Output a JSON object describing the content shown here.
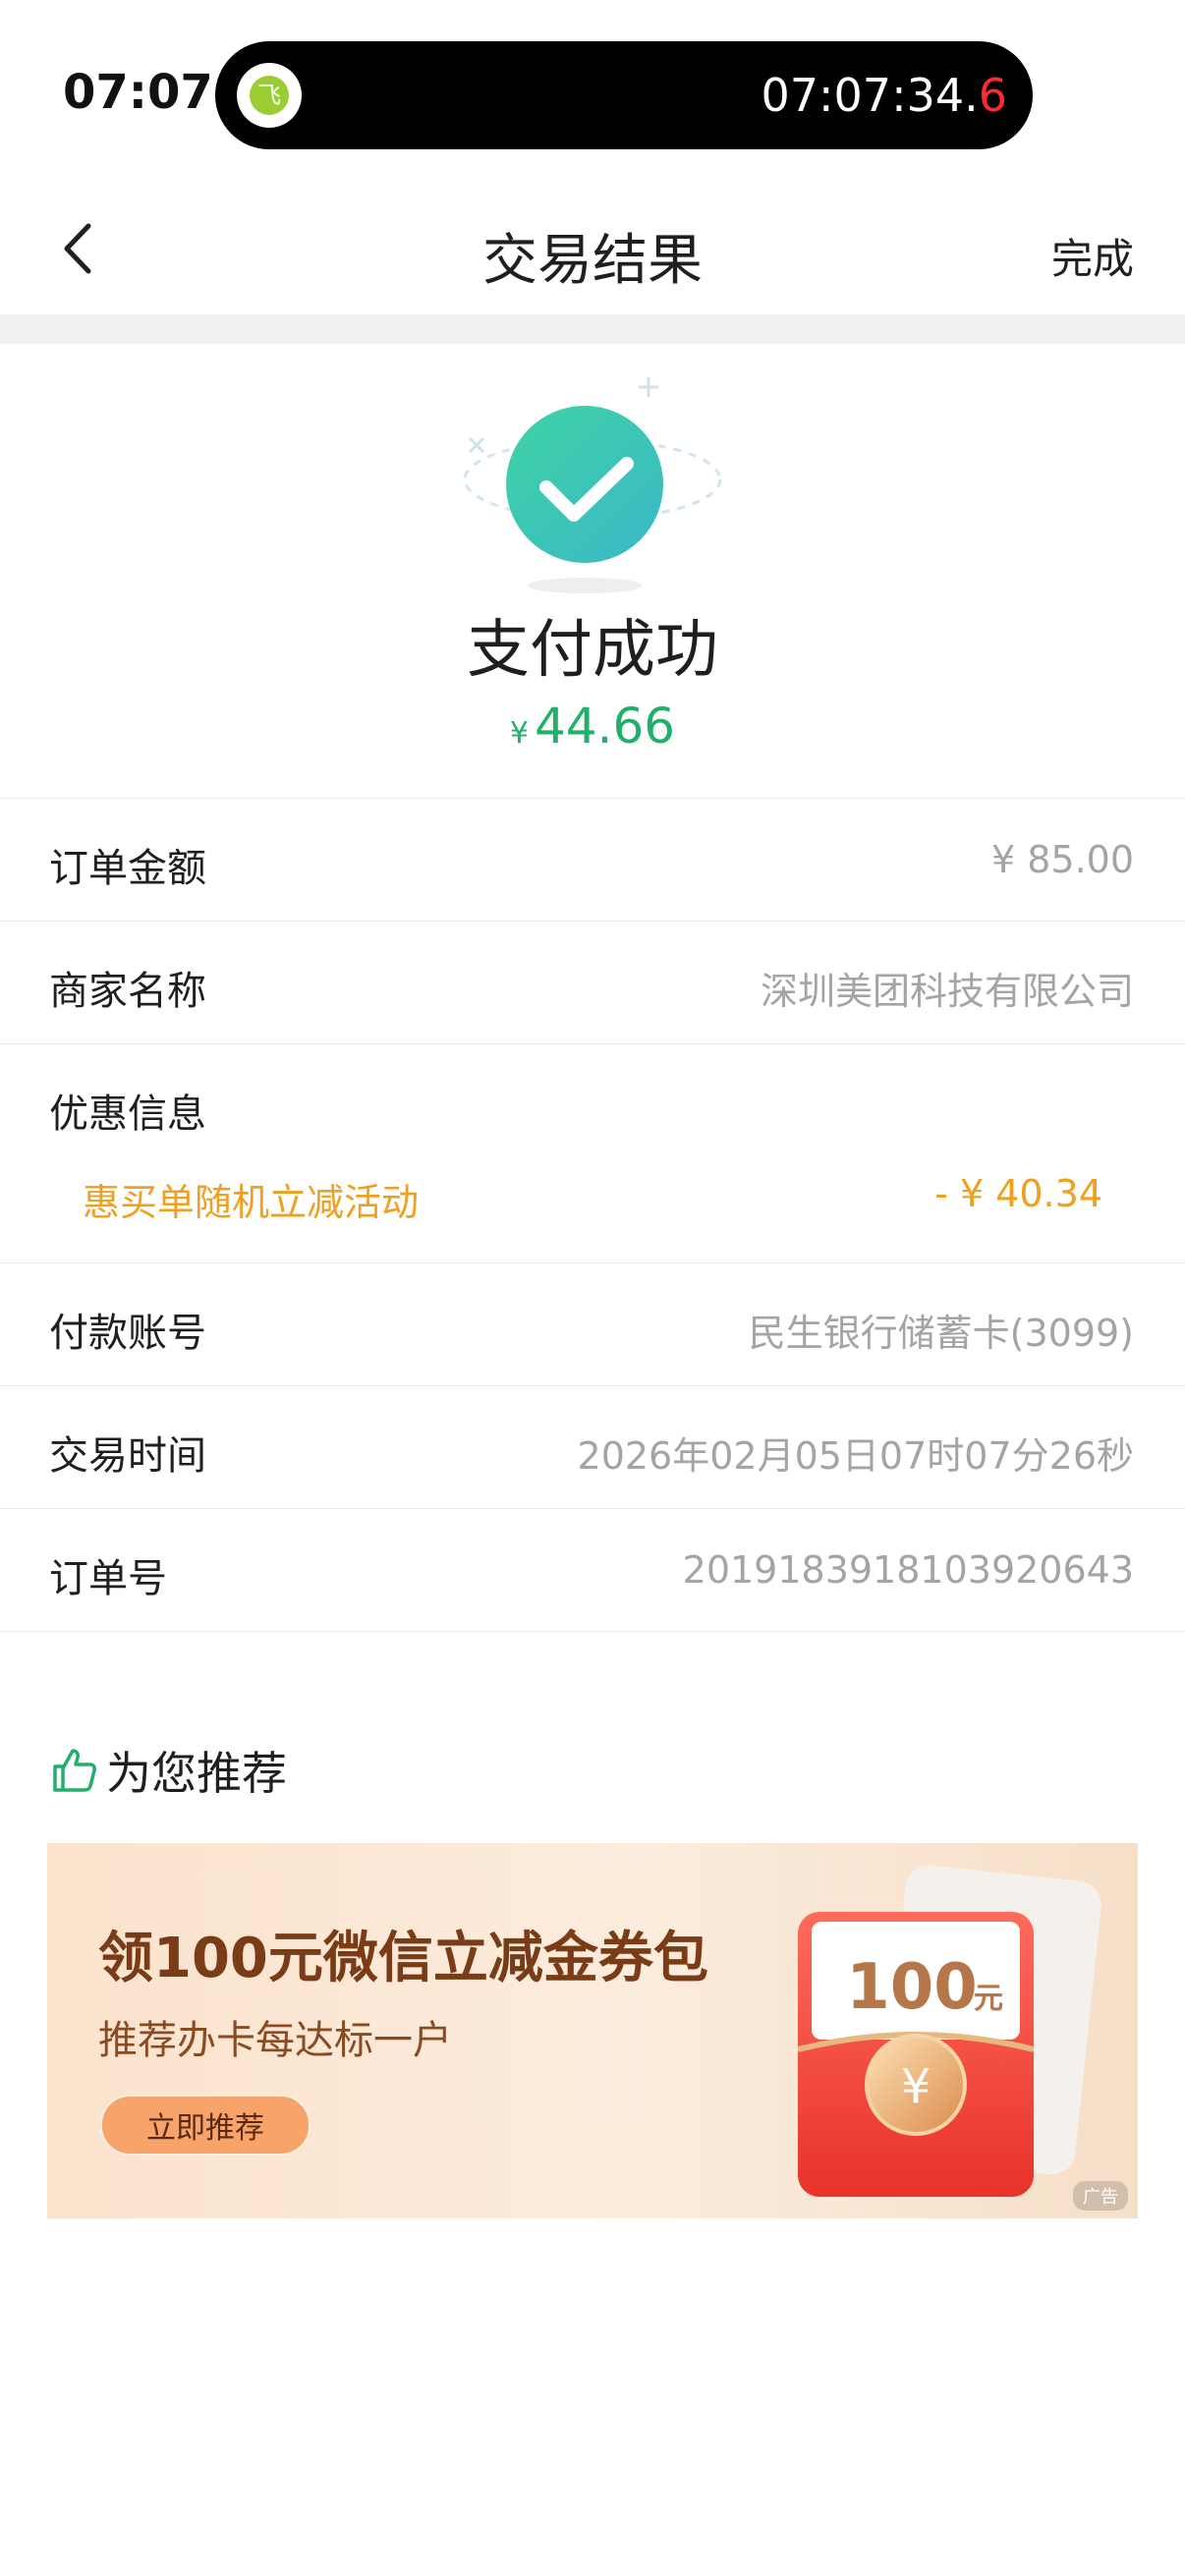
{
  "status_bar": {
    "time": "07:07",
    "clock_main": "07:07:34.",
    "clock_tenth": "6",
    "logo_glyph": "飞"
  },
  "nav": {
    "back_icon": "chevron-left-icon",
    "title": "交易结果",
    "done_label": "完成"
  },
  "result": {
    "icon": "check-circle-icon",
    "title": "支付成功",
    "currency": "¥",
    "amount": "44.66",
    "accent": "#20b06b"
  },
  "details": {
    "order_amount": {
      "label": "订单金额",
      "value": "¥ 85.00"
    },
    "merchant": {
      "label": "商家名称",
      "value": "深圳美团科技有限公司"
    },
    "discount": {
      "label": "优惠信息",
      "name": "惠买单随机立减活动",
      "value": "- ¥ 40.34",
      "color": "#f0a020"
    },
    "account": {
      "label": "付款账号",
      "value": "民生银行储蓄卡(3099)"
    },
    "time": {
      "label": "交易时间",
      "value": "2026年02月05日07时07分26秒"
    },
    "order_no": {
      "label": "订单号",
      "value": "2019183918103920643"
    }
  },
  "recommend": {
    "icon": "thumbs-up-icon",
    "title": "为您推荐"
  },
  "ad": {
    "headline": "领100元微信立减金券包",
    "subtitle": "推荐办卡每达标一户",
    "button_label": "立即推荐",
    "art_amount": "100",
    "art_unit": "元",
    "coin_glyph": "¥",
    "tag": "广告"
  }
}
